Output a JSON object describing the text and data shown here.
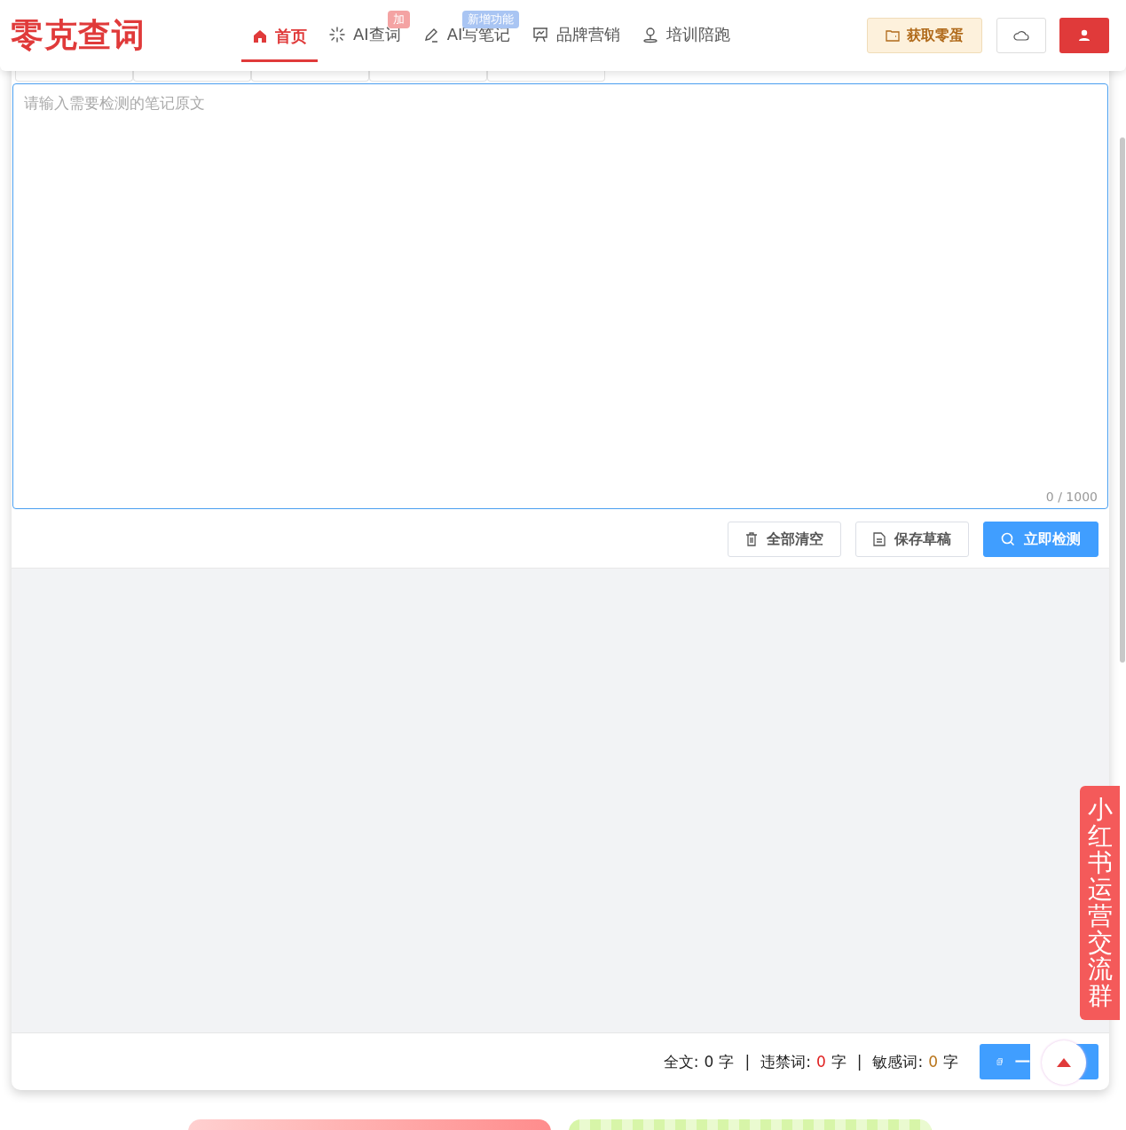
{
  "logo": "零克查词",
  "nav": [
    {
      "label": "首页",
      "selected": true
    },
    {
      "label": "AI查词",
      "selected": false,
      "badge": {
        "text": "加",
        "color": "#f4a3a3"
      }
    },
    {
      "label": "AI写笔记",
      "selected": false,
      "badge": {
        "text": "新增功能",
        "color": "#a9c5f3"
      }
    },
    {
      "label": "品牌营销",
      "selected": false
    },
    {
      "label": "培训陪跑",
      "selected": false
    }
  ],
  "coins_button": "获取零蛋",
  "editor": {
    "placeholder": "请输入需要检测的笔记原文",
    "counter": "0 / 1000"
  },
  "buttons": [
    {
      "label": "全部清空",
      "kind": "clear"
    },
    {
      "label": "保存草稿",
      "kind": "save"
    },
    {
      "label": "立即检测",
      "kind": "check"
    }
  ],
  "stats": [
    {
      "label": "全文:",
      "count": "0",
      "unit": "字",
      "color": "#222222"
    },
    {
      "separator": "|",
      "label": "违禁词:",
      "count": "0",
      "unit": "字",
      "color": "#e02020"
    },
    {
      "separator": "|",
      "label": "敏感词:",
      "count": "0",
      "unit": "字",
      "color": "#b8741a"
    }
  ],
  "copy_button": "一",
  "side_tab": "小红书运营交流群"
}
